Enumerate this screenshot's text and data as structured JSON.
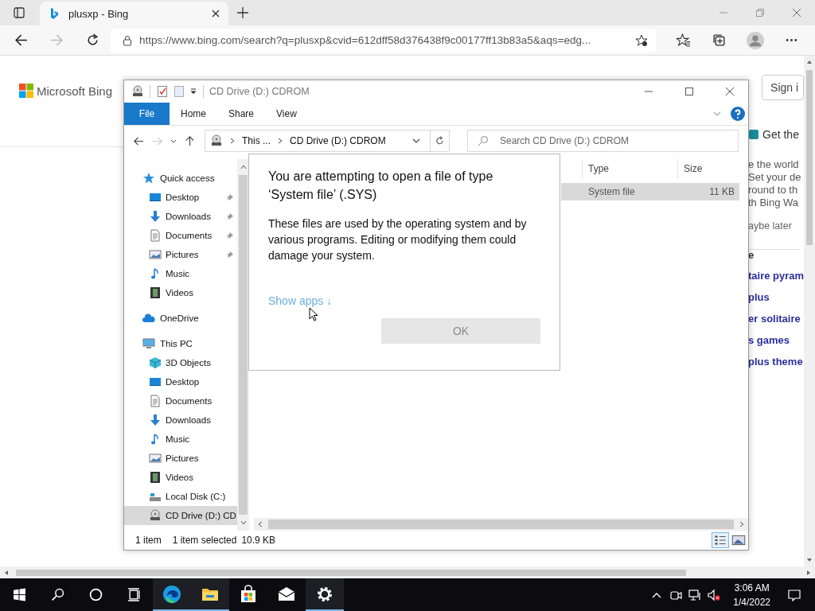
{
  "browser": {
    "tab": {
      "title": "plusxp - Bing"
    },
    "url": "https://www.bing.com/search?q=plusxp&cvid=612dff58d376438f9c00177ff13b83a5&aqs=edg..."
  },
  "bing": {
    "logo": "Microsoft Bing",
    "sign_in": "Sign i",
    "promo": {
      "title": "Get the",
      "lines": [
        "e the world",
        "Set your de",
        "round to th",
        "th Bing Wa"
      ],
      "dismiss": "aybe later"
    },
    "related_heading": "e",
    "related": [
      "taire pyram",
      "plus",
      "er solitaire",
      "s games",
      "plus theme"
    ]
  },
  "explorer": {
    "title": "CD Drive (D:) CDROM",
    "ribbon_tabs": [
      {
        "label": "File",
        "selected": true
      },
      {
        "label": "Home",
        "selected": false
      },
      {
        "label": "Share",
        "selected": false
      },
      {
        "label": "View",
        "selected": false
      }
    ],
    "breadcrumb": [
      "This ...",
      "CD Drive (D:) CDROM"
    ],
    "search": {
      "placeholder": "Search CD Drive (D:) CDROM"
    },
    "nav": [
      {
        "label": "Quick access",
        "kind": "star",
        "selected": false,
        "children": [
          {
            "label": "Desktop",
            "kind": "desktop",
            "pinned": true,
            "selected": false
          },
          {
            "label": "Downloads",
            "kind": "download",
            "pinned": true,
            "selected": false
          },
          {
            "label": "Documents",
            "kind": "document",
            "pinned": true,
            "selected": false
          },
          {
            "label": "Pictures",
            "kind": "pictures",
            "pinned": true,
            "selected": false
          },
          {
            "label": "Music",
            "kind": "music",
            "pinned": false,
            "selected": false
          },
          {
            "label": "Videos",
            "kind": "videos",
            "pinned": false,
            "selected": false
          }
        ]
      },
      {
        "label": "OneDrive",
        "kind": "cloud",
        "selected": false
      },
      {
        "label": "This PC",
        "kind": "pc",
        "selected": false,
        "children": [
          {
            "label": "3D Objects",
            "kind": "cube",
            "pinned": false,
            "selected": false
          },
          {
            "label": "Desktop",
            "kind": "desktop",
            "pinned": false,
            "selected": false
          },
          {
            "label": "Documents",
            "kind": "document",
            "pinned": false,
            "selected": false
          },
          {
            "label": "Downloads",
            "kind": "download",
            "pinned": false,
            "selected": false
          },
          {
            "label": "Music",
            "kind": "music",
            "pinned": false,
            "selected": false
          },
          {
            "label": "Pictures",
            "kind": "pictures",
            "pinned": false,
            "selected": false
          },
          {
            "label": "Videos",
            "kind": "videos",
            "pinned": false,
            "selected": false
          },
          {
            "label": "Local Disk (C:)",
            "kind": "disk",
            "pinned": false,
            "selected": false
          },
          {
            "label": "CD Drive (D:) CD",
            "kind": "cdrom",
            "pinned": false,
            "selected": true
          }
        ]
      }
    ],
    "columns": [
      "Type",
      "Size"
    ],
    "rows": [
      {
        "type": "System file",
        "size": "11 KB",
        "selected": true
      }
    ],
    "status": [
      "1 item",
      "1 item selected",
      "10.9 KB"
    ]
  },
  "dialog": {
    "title": "You are attempting to open a file of type ‘System file’ (.SYS)",
    "body": "These files are used by the operating system and by various programs. Editing or modifying them could damage your system.",
    "show_apps": "Show apps ↓",
    "ok": {
      "label": "OK",
      "disabled": true
    }
  },
  "taskbar": {
    "apps": [
      {
        "kind": "edge",
        "running": true
      },
      {
        "kind": "explorer",
        "running": true
      },
      {
        "kind": "store",
        "running": false
      },
      {
        "kind": "mail",
        "running": false
      },
      {
        "kind": "settings",
        "running": true
      }
    ],
    "time": "3:06 AM",
    "date": "1/4/2022"
  }
}
